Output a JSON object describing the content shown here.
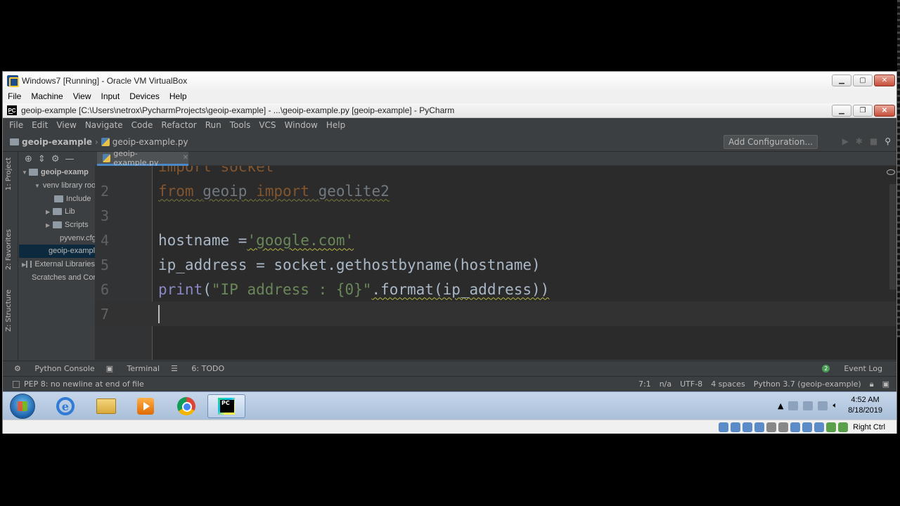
{
  "vbox": {
    "title": "Windows7 [Running] - Oracle VM VirtualBox",
    "menu": [
      "File",
      "Machine",
      "View",
      "Input",
      "Devices",
      "Help"
    ],
    "status_label": "Right Ctrl"
  },
  "pycharm": {
    "title": "geoip-example [C:\\Users\\netrox\\PycharmProjects\\geoip-example] - ...\\geoip-example.py [geoip-example] - PyCharm",
    "menu": [
      "File",
      "Edit",
      "View",
      "Navigate",
      "Code",
      "Refactor",
      "Run",
      "Tools",
      "VCS",
      "Window",
      "Help"
    ],
    "breadcrumb": {
      "project": "geoip-example",
      "file": "geoip-example.py"
    },
    "add_configuration": "Add Configuration...",
    "tool_stripe": {
      "project": "1: Project",
      "favorites": "2: Favorites",
      "structure": "Z: Structure"
    },
    "project_tree": [
      {
        "label": "geoip-examp",
        "bold": true
      },
      {
        "label": "venv library root"
      },
      {
        "label": "Include"
      },
      {
        "label": "Lib"
      },
      {
        "label": "Scripts"
      },
      {
        "label": "pyvenv.cfg"
      },
      {
        "label": "geoip-example.py"
      },
      {
        "label": "External Libraries"
      },
      {
        "label": "Scratches and Consoles"
      }
    ],
    "editor": {
      "tab": "geoip-example.py",
      "line_numbers": [
        "2",
        "3",
        "4",
        "5",
        "6",
        "7"
      ],
      "line1_partial": "import socket",
      "line2": {
        "kw": "from",
        "mod": "geoip",
        "kw2": "import",
        "name": "geolite2"
      },
      "line4": {
        "var": "hostname =",
        "str": "'google.com'"
      },
      "line5": "ip_address = socket.gethostbyname(hostname)",
      "line6": {
        "fn": "print",
        "open": "(",
        "str": "\"IP address : {0}\"",
        "rest": ".format(ip_address))"
      }
    },
    "bottom_tools": {
      "python_console": "Python Console",
      "terminal": "Terminal",
      "todo": "6: TODO",
      "event_log": "Event Log",
      "event_count": "2"
    },
    "status": {
      "message": "PEP 8: no newline at end of file",
      "position": "7:1",
      "na": "n/a",
      "encoding": "UTF-8",
      "indent": "4 spaces",
      "interpreter": "Python 3.7 (geoip-example)"
    }
  },
  "taskbar": {
    "time": "4:52 AM",
    "date": "8/18/2019"
  }
}
